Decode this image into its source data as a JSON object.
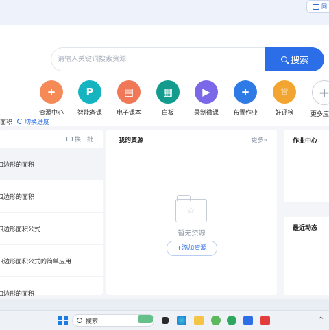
{
  "topbar": {
    "pill_label": "网"
  },
  "search": {
    "placeholder": "请输入关键词搜索资源",
    "button_label": "搜索"
  },
  "tools": [
    {
      "label": "资源中心",
      "icon": "resource-center-icon",
      "color": "#f58a56",
      "glyph": "+"
    },
    {
      "label": "智能备课",
      "icon": "smart-prep-icon",
      "color": "#16b4c0",
      "glyph": "P"
    },
    {
      "label": "电子课本",
      "icon": "ebook-icon",
      "color": "#f07856",
      "glyph": "▤"
    },
    {
      "label": "白板",
      "icon": "whiteboard-icon",
      "color": "#139b8e",
      "glyph": "▦"
    },
    {
      "label": "录制微课",
      "icon": "record-icon",
      "color": "#7b68e8",
      "glyph": "▶"
    },
    {
      "label": "布置作业",
      "icon": "assignment-icon",
      "color": "#2f7be6",
      "glyph": "+"
    },
    {
      "label": "好评榜",
      "icon": "trophy-icon",
      "color": "#f2a531",
      "glyph": "♕"
    },
    {
      "label": "更多应",
      "icon": "more-apps-icon",
      "color": "#ffffff",
      "glyph": "+"
    }
  ],
  "course": {
    "title": "面积",
    "switch_label": "切换进度"
  },
  "recommend": {
    "refresh_label": "换一批",
    "items": [
      "四边形的面积",
      "四边形的面积",
      "四边形面积公式",
      "四边形面积公式的简单应用",
      "四边形的面积"
    ]
  },
  "my_resources": {
    "title": "我的资源",
    "more_label": "更多»",
    "empty_text": "暂无资源",
    "add_label": "+添加资源"
  },
  "right": {
    "homework_title": "作业中心",
    "activity_title": "最近动态"
  },
  "taskbar": {
    "search_label": "搜索"
  }
}
